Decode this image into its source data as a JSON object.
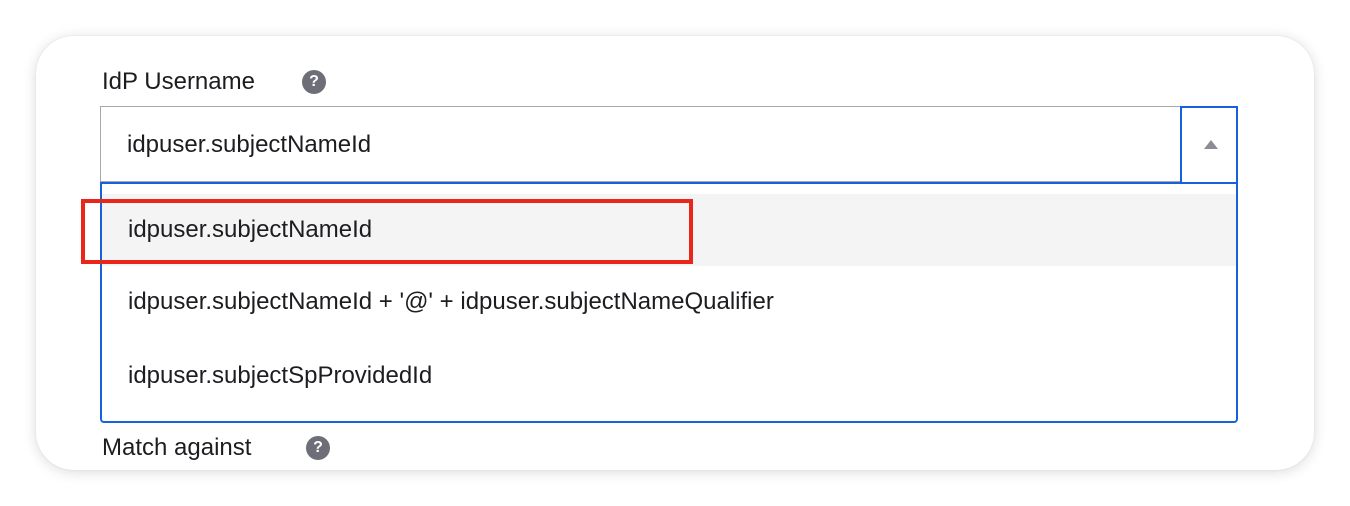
{
  "idp_username": {
    "label": "IdP Username",
    "help_icon": "?",
    "selected_value": "idpuser.subjectNameId",
    "options": [
      "idpuser.subjectNameId",
      "idpuser.subjectNameId + '@' + idpuser.subjectNameQualifier",
      "idpuser.subjectSpProvidedId"
    ]
  },
  "match_against": {
    "label": "Match against",
    "help_icon": "?"
  },
  "colors": {
    "focus_border": "#1662dd",
    "highlight_annotation": "#e8271a",
    "hover_option_bg": "#f4f4f4",
    "help_icon_bg": "#6e6e78"
  },
  "icons": {
    "help": "question-circle-icon",
    "toggle": "caret-up-icon"
  }
}
